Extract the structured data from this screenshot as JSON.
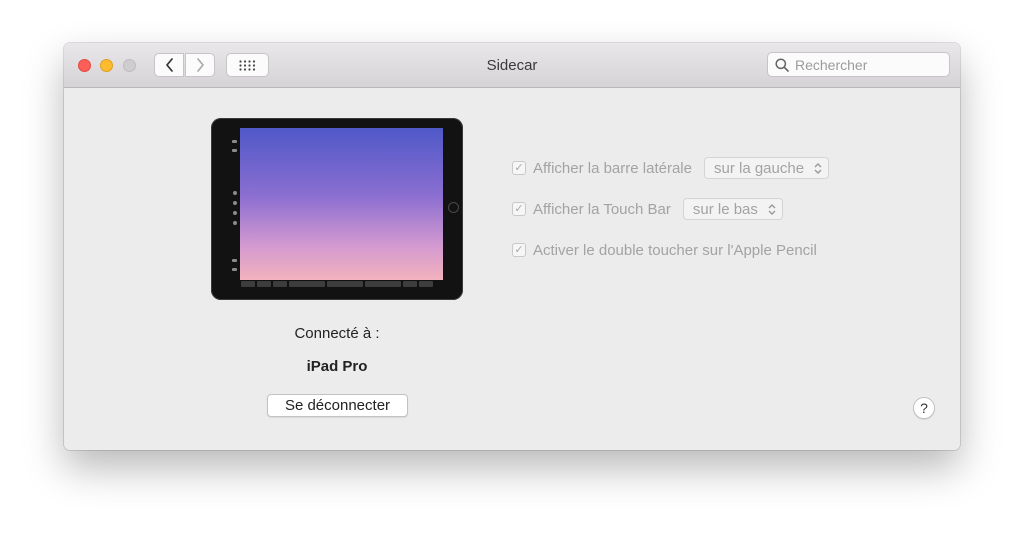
{
  "window": {
    "title": "Sidecar",
    "search_placeholder": "Rechercher"
  },
  "device": {
    "connected_label": "Connecté à :",
    "name": "iPad Pro",
    "disconnect_label": "Se déconnecter"
  },
  "options": [
    {
      "label": "Afficher la barre latérale",
      "checked": true,
      "select_value": "sur la gauche"
    },
    {
      "label": "Afficher la Touch Bar",
      "checked": true,
      "select_value": "sur le bas"
    },
    {
      "label": "Activer le double toucher sur l'Apple Pencil",
      "checked": true
    }
  ],
  "help": {
    "label": "?"
  },
  "icons": {
    "back": "chevron-left-icon",
    "forward": "chevron-right-icon",
    "grid": "grid-icon",
    "search": "magnifier-icon",
    "check": "checkmark-icon"
  },
  "colors": {
    "close": "#fc5f57",
    "minimize": "#fdbc2e",
    "zoom": "#cfcdcf",
    "window_bg": "#ececec"
  }
}
